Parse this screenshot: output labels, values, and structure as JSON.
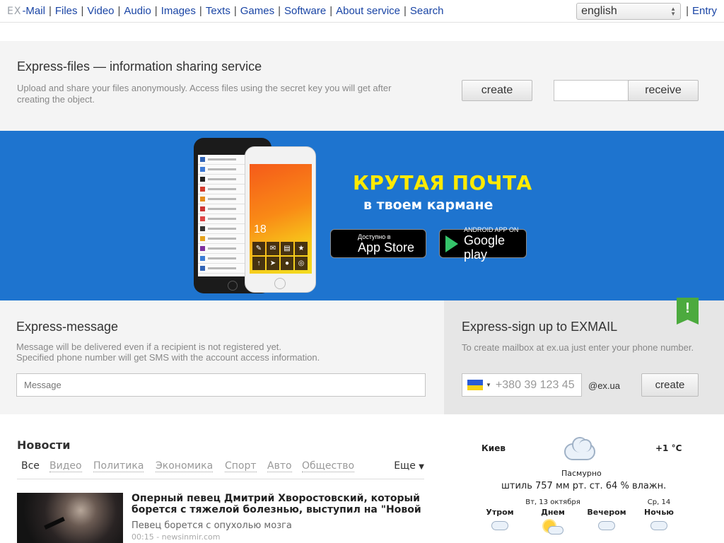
{
  "topbar": {
    "logo": "EX",
    "links": [
      "-Mail",
      "Files",
      "Video",
      "Audio",
      "Images",
      "Texts",
      "Games",
      "Software",
      "About service",
      "Search"
    ],
    "language": "english",
    "entry": "Entry"
  },
  "files": {
    "title": "Express-files — information sharing service",
    "desc": "Upload and share your files anonymously. Access files using the secret key you will get after creating the object.",
    "create_label": "create",
    "receive_label": "receive",
    "key_value": ""
  },
  "banner": {
    "headline": "КРУТАЯ ПОЧТА",
    "subline": "в твоем кармане",
    "phone_clock": "18",
    "appstore_small": "Доступно в",
    "appstore_large": "App Store",
    "googleplay_small": "ANDROID APP ON",
    "googleplay_large": "Google play"
  },
  "message": {
    "title": "Express-message",
    "desc_line1": "Message will be delivered even if a recipient is not registered yet.",
    "desc_line2": "Specified phone number will get SMS with the account access information.",
    "placeholder": "Message"
  },
  "signup": {
    "title": "Express-sign up to EXMAIL",
    "desc": "To create mailbox at ex.ua just enter your phone number.",
    "badge": "!",
    "phone_placeholder": "+380 39 123 45",
    "domain": "@ex.ua",
    "create_label": "create",
    "flag_colors": [
      "#2a5bd7",
      "#f7d117"
    ]
  },
  "news": {
    "title": "Новости",
    "tabs": [
      "Все",
      "Видео",
      "Политика",
      "Экономика",
      "Спорт",
      "Авто",
      "Общество"
    ],
    "more": "Еще",
    "item": {
      "headline": "Оперный певец Дмитрий Хворостовский, который борется с тяжелой болезнью, выступил на \"Новой",
      "subtitle": "Певец борется с опухолью мозга",
      "meta": "00:15 - newsinmir.com"
    }
  },
  "weather": {
    "city": "Киев",
    "temp": "+1 °C",
    "condition": "Пасмурно",
    "details": "штиль  757 мм рт. ст.  64 % влажн.",
    "periods": [
      {
        "date": "",
        "label": "Утром",
        "icon": "cloud-icon"
      },
      {
        "date": "Вт, 13 октября",
        "label": "Днем",
        "icon": "sun-cloud-icon"
      },
      {
        "date": "",
        "label": "Вечером",
        "icon": "cloud-icon"
      },
      {
        "date": "Ср, 14",
        "label": "Ночью",
        "icon": "cloud-icon"
      }
    ]
  }
}
